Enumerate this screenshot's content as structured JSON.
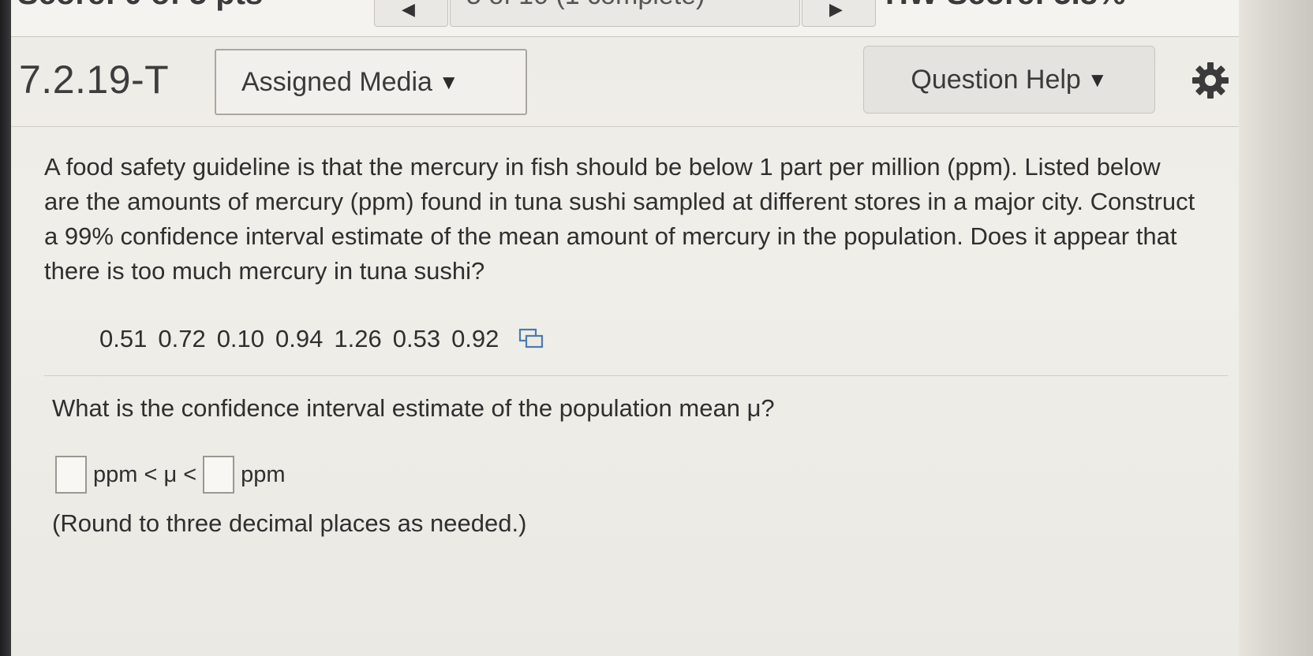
{
  "topbar": {
    "score_text": "Score: 0 of 5 pts",
    "nav_middle_text": "5 of 10 (1 complete)",
    "hw_score_text": "HW Score: 5.8%"
  },
  "question": {
    "id": "7.2.19-T",
    "assigned_media_label": "Assigned Media",
    "question_help_label": "Question Help",
    "text": "A food safety guideline is that the mercury in fish should be below 1 part per million (ppm). Listed below are the amounts of mercury (ppm) found in tuna sushi sampled at different stores in a major city. Construct a 99% confidence interval estimate of the mean amount of mercury in the population. Does it appear that there is too much mercury in tuna sushi?",
    "data_values": [
      "0.51",
      "0.72",
      "0.10",
      "0.94",
      "1.26",
      "0.53",
      "0.92"
    ],
    "prompt": "What is the confidence interval estimate of the population mean μ?",
    "answer_unit_1": "ppm < μ <",
    "answer_unit_2": "ppm",
    "lower_value": "",
    "upper_value": "",
    "note": "(Round to three decimal places as needed.)"
  },
  "icons": {
    "gear": "gear-icon",
    "copy": "copy-data-icon",
    "caret": "caret-down-icon"
  }
}
